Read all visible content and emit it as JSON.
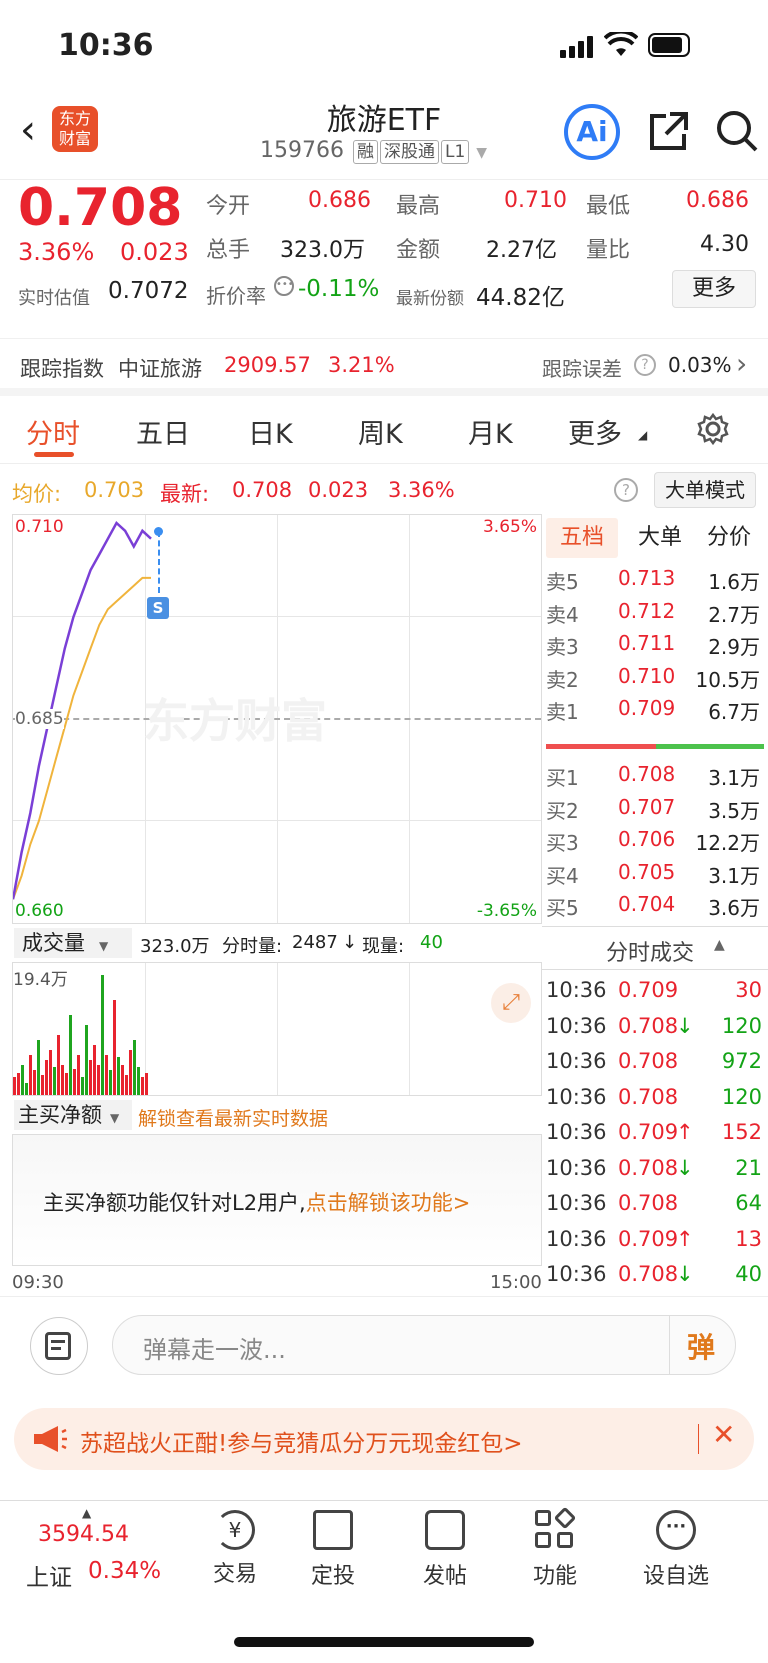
{
  "status": {
    "time": "10:36"
  },
  "header": {
    "title": "旅游ETF",
    "code": "159766",
    "tags": [
      "融",
      "深股通",
      "L1"
    ],
    "logo_text": [
      "东方",
      "财富"
    ],
    "ai_label": "Ai"
  },
  "quote": {
    "price": "0.708",
    "change_pct": "3.36%",
    "change": "0.023",
    "realtime_est_label": "实时估值",
    "realtime_est": "0.7072",
    "open_label": "今开",
    "open": "0.686",
    "high_label": "最高",
    "high": "0.710",
    "low_label": "最低",
    "low": "0.686",
    "volume_label": "总手",
    "volume": "323.0万",
    "amount_label": "金额",
    "amount": "2.27亿",
    "vol_ratio_label": "量比",
    "vol_ratio": "4.30",
    "discount_label": "折价率",
    "discount": "-0.11%",
    "shares_label": "最新份额",
    "shares": "44.82亿",
    "more_button": "更多"
  },
  "tracking": {
    "label": "跟踪指数",
    "index_name": "中证旅游",
    "index_value": "2909.57",
    "index_pct": "3.21%",
    "error_label": "跟踪误差",
    "error_value": "0.03%"
  },
  "tabs": [
    "分时",
    "五日",
    "日K",
    "周K",
    "月K",
    "更多"
  ],
  "avgbar": {
    "avg_label": "均价:",
    "avg": "0.703",
    "latest_label": "最新:",
    "latest": "0.708",
    "change": "0.023",
    "pct": "3.36%",
    "mode_button": "大单模式"
  },
  "chart_labels": {
    "top_price": "0.710",
    "top_pct": "3.65%",
    "mid_price": "0.685",
    "bottom_price": "0.660",
    "bottom_pct": "-3.65%",
    "start_time": "09:30",
    "end_time": "15:00",
    "s_marker": "S",
    "watermark": "东方财富"
  },
  "chart_data": {
    "type": "line",
    "x_range": [
      "09:30",
      "15:00"
    ],
    "ylim": [
      0.66,
      0.71
    ],
    "series": [
      {
        "values": [
          0.662,
          0.668,
          0.673,
          0.679,
          0.684,
          0.689,
          0.694,
          0.698,
          0.701,
          0.704,
          0.706,
          0.708,
          0.71,
          0.709,
          0.707,
          0.709,
          0.708
        ]
      },
      {
        "values": [
          0.662,
          0.665,
          0.669,
          0.672,
          0.676,
          0.68,
          0.684,
          0.688,
          0.691,
          0.694,
          0.697,
          0.699,
          0.7,
          0.701,
          0.702,
          0.703,
          0.703
        ]
      }
    ]
  },
  "volume": {
    "selector": "成交量",
    "total": "323.0万",
    "tick_label": "分时量:",
    "tick_vol": "2487",
    "current_label": "现量:",
    "current": "40",
    "ymax": "19.4万"
  },
  "netbuy": {
    "selector": "主买净额",
    "unlock_text": "解锁查看最新实时数据",
    "notice": "主买净额功能仅针对L2用户,",
    "notice_link": "点击解锁该功能>"
  },
  "orderbook": {
    "tabs": [
      "五档",
      "大单",
      "分价"
    ],
    "asks": [
      [
        "卖5",
        "0.713",
        "1.6万"
      ],
      [
        "卖4",
        "0.712",
        "2.7万"
      ],
      [
        "卖3",
        "0.711",
        "2.9万"
      ],
      [
        "卖2",
        "0.710",
        "10.5万"
      ],
      [
        "卖1",
        "0.709",
        "6.7万"
      ]
    ],
    "bids": [
      [
        "买1",
        "0.708",
        "3.1万"
      ],
      [
        "买2",
        "0.707",
        "3.5万"
      ],
      [
        "买3",
        "0.706",
        "12.2万"
      ],
      [
        "买4",
        "0.705",
        "3.1万"
      ],
      [
        "买5",
        "0.704",
        "3.6万"
      ]
    ]
  },
  "ticks": {
    "title": "分时成交",
    "rows": [
      [
        "10:36",
        "0.709",
        "",
        "30",
        "red"
      ],
      [
        "10:36",
        "0.708",
        "↓",
        "120",
        "green"
      ],
      [
        "10:36",
        "0.708",
        "",
        "972",
        "green"
      ],
      [
        "10:36",
        "0.708",
        "",
        "120",
        "green"
      ],
      [
        "10:36",
        "0.709",
        "↑",
        "152",
        "red"
      ],
      [
        "10:36",
        "0.708",
        "↓",
        "21",
        "green"
      ],
      [
        "10:36",
        "0.708",
        "",
        "64",
        "green"
      ],
      [
        "10:36",
        "0.709",
        "↑",
        "13",
        "red"
      ],
      [
        "10:36",
        "0.708",
        "↓",
        "40",
        "green"
      ]
    ]
  },
  "comment": {
    "placeholder": "弹幕走一波...",
    "danmu_button": "弹"
  },
  "banner": {
    "text": "苏超战火正酣!参与竞猜瓜分万元现金红包>"
  },
  "bottom": {
    "index_value": "3594.54",
    "index_name": "上证",
    "index_pct": "0.34%",
    "nav": [
      "交易",
      "定投",
      "发帖",
      "功能",
      "设自选"
    ]
  }
}
